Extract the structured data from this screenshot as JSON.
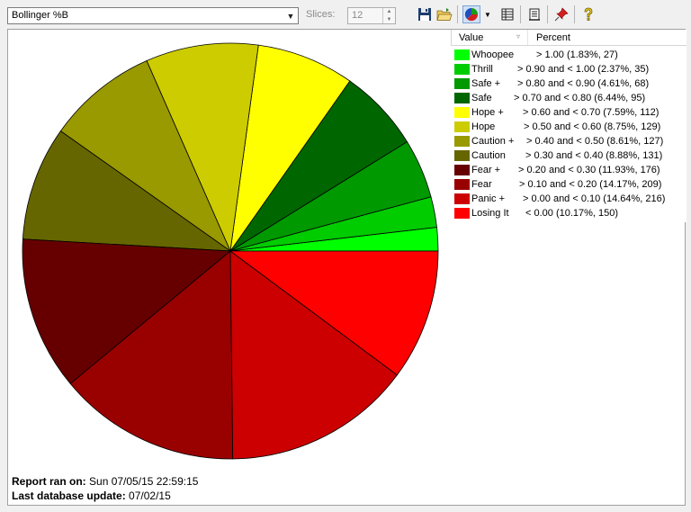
{
  "toolbar": {
    "indicator_value": "Bollinger %B",
    "slices_label": "Slices:",
    "slices_value": "12",
    "icons": [
      "save-icon",
      "open-folder-icon",
      "pie-chart-icon",
      "dropdown-arrow-icon",
      "table-icon",
      "list-icon",
      "pin-icon",
      "help-icon"
    ]
  },
  "legend": {
    "value_header": "Value",
    "percent_header": "Percent"
  },
  "footer": {
    "report_label": "Report ran on:",
    "report_value": "Sun 07/05/15 22:59:15",
    "db_label": "Last database update:",
    "db_value": "07/02/15"
  },
  "chart_data": {
    "type": "pie",
    "title": "",
    "slices": [
      {
        "name": "Whoopee",
        "range": "> 1.00",
        "percent": 1.83,
        "count": 27,
        "color": "#00ff00",
        "label": "> 1.00 (1.83%, 27)"
      },
      {
        "name": "Thrill",
        "range": "> 0.90 and < 1.00",
        "percent": 2.37,
        "count": 35,
        "color": "#00cc00",
        "label": "> 0.90 and < 1.00 (2.37%, 35)"
      },
      {
        "name": "Safe +",
        "range": "> 0.80 and < 0.90",
        "percent": 4.61,
        "count": 68,
        "color": "#009900",
        "label": "> 0.80 and < 0.90 (4.61%, 68)"
      },
      {
        "name": "Safe",
        "range": "> 0.70 and < 0.80",
        "percent": 6.44,
        "count": 95,
        "color": "#006600",
        "label": "> 0.70 and < 0.80 (6.44%, 95)"
      },
      {
        "name": "Hope +",
        "range": "> 0.60 and < 0.70",
        "percent": 7.59,
        "count": 112,
        "color": "#ffff00",
        "label": "> 0.60 and < 0.70 (7.59%, 112)"
      },
      {
        "name": "Hope",
        "range": "> 0.50 and < 0.60",
        "percent": 8.75,
        "count": 129,
        "color": "#cccc00",
        "label": "> 0.50 and < 0.60 (8.75%, 129)"
      },
      {
        "name": "Caution +",
        "range": "> 0.40 and < 0.50",
        "percent": 8.61,
        "count": 127,
        "color": "#999900",
        "label": "> 0.40 and < 0.50 (8.61%, 127)"
      },
      {
        "name": "Caution",
        "range": "> 0.30 and < 0.40",
        "percent": 8.88,
        "count": 131,
        "color": "#666600",
        "label": "> 0.30 and < 0.40 (8.88%, 131)"
      },
      {
        "name": "Fear +",
        "range": "> 0.20 and < 0.30",
        "percent": 11.93,
        "count": 176,
        "color": "#660000",
        "label": "> 0.20 and < 0.30 (11.93%, 176)"
      },
      {
        "name": "Fear",
        "range": "> 0.10 and < 0.20",
        "percent": 14.17,
        "count": 209,
        "color": "#990000",
        "label": "> 0.10 and < 0.20 (14.17%, 209)"
      },
      {
        "name": "Panic +",
        "range": "> 0.00 and < 0.10",
        "percent": 14.64,
        "count": 216,
        "color": "#cc0000",
        "label": "> 0.00 and < 0.10 (14.64%, 216)"
      },
      {
        "name": "Losing It",
        "range": "< 0.00",
        "percent": 10.17,
        "count": 150,
        "color": "#ff0000",
        "label": "< 0.00 (10.17%, 150)"
      }
    ]
  }
}
